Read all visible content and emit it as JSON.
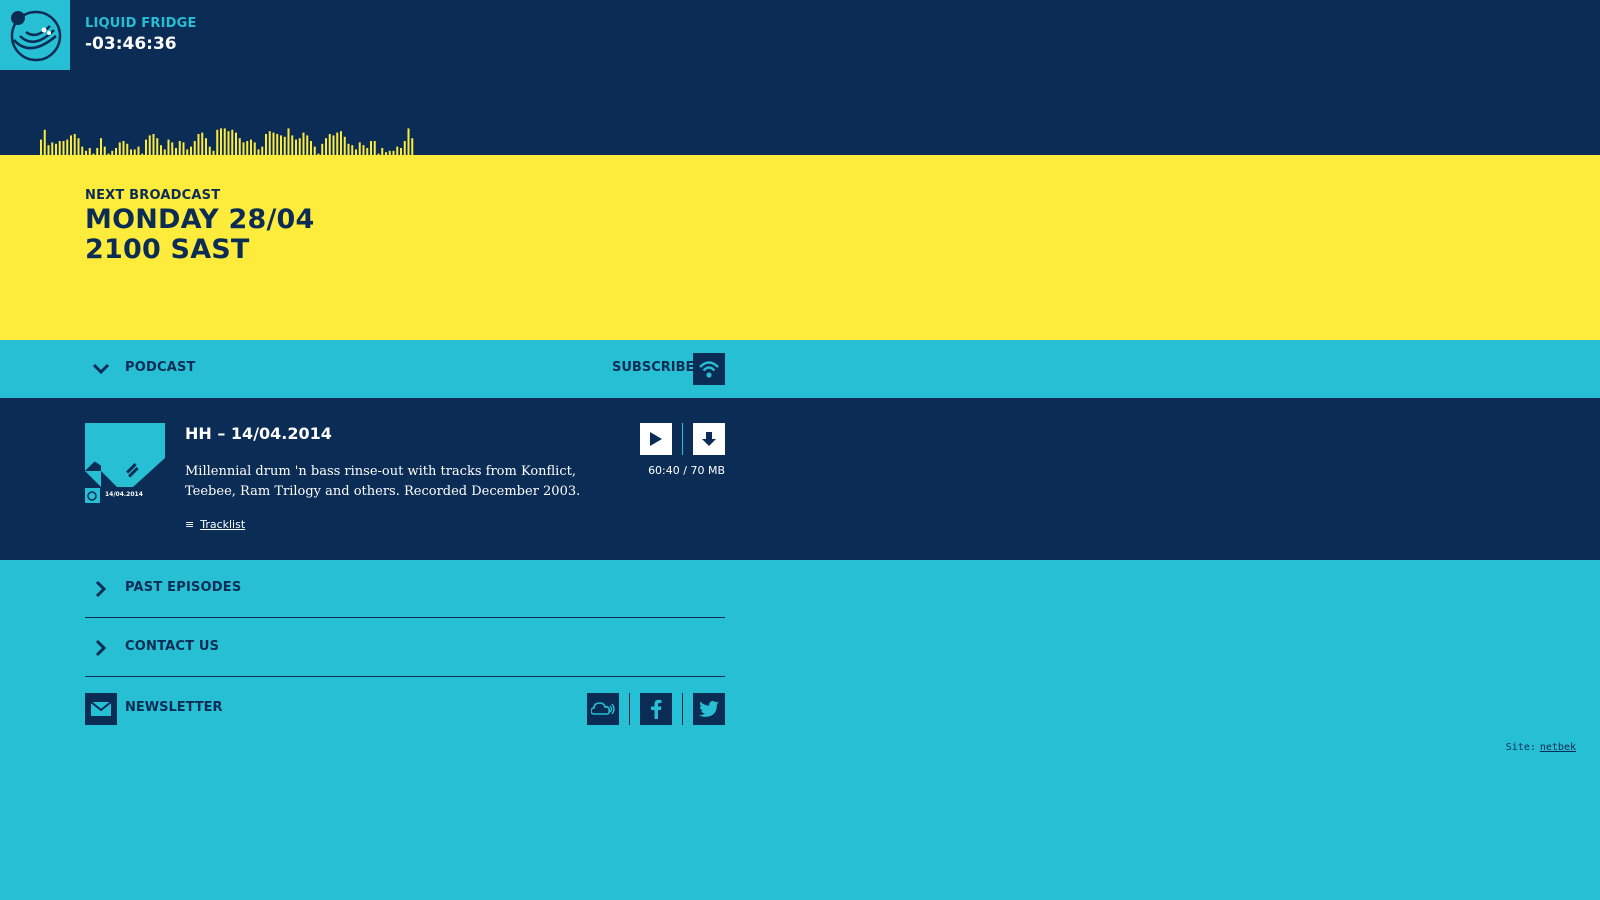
{
  "player": {
    "station_name": "LIQUID FRIDGE",
    "countdown": "-03:46:36",
    "equalizer_levels": [
      0.55,
      0.9,
      0.35,
      0.45,
      0.4,
      0.5,
      0.5,
      0.55,
      0.7,
      0.75,
      0.6,
      0.3,
      0.15,
      0.25,
      0.05,
      0.25,
      0.6,
      0.3,
      0.05,
      0.15,
      0.25,
      0.45,
      0.5,
      0.4,
      0.2,
      0.2,
      0.3,
      0.05,
      0.55,
      0.7,
      0.75,
      0.6,
      0.35,
      0.2,
      0.55,
      0.45,
      0.25,
      0.5,
      0.45,
      0.2,
      0.3,
      0.5,
      0.75,
      0.8,
      0.6,
      0.3,
      0.15,
      0.9,
      0.95,
      0.95,
      0.85,
      0.9,
      0.8,
      0.6,
      0.45,
      0.5,
      0.55,
      0.45,
      0.2,
      0.3,
      0.75,
      0.85,
      0.8,
      0.75,
      0.7,
      0.65,
      0.95,
      0.7,
      0.55,
      0.6,
      0.8,
      0.7,
      0.5,
      0.3,
      0.05,
      0.4,
      0.6,
      0.75,
      0.7,
      0.8,
      0.85,
      0.65,
      0.4,
      0.35,
      0.2,
      0.45,
      0.35,
      0.25,
      0.5,
      0.5,
      0.05,
      0.25,
      0.1,
      0.15,
      0.15,
      0.3,
      0.25,
      0.5,
      0.95,
      0.6
    ]
  },
  "next_broadcast": {
    "label": "NEXT BROADCAST",
    "date": "MONDAY 28/04",
    "time": "2100 SAST"
  },
  "podcast": {
    "label": "PODCAST",
    "subscribe_label": "SUBSCRIBE",
    "episode": {
      "title": "HH – 14/04.2014",
      "description": "Millennial drum 'n bass rinse-out with tracks from Konflict, Teebee, Ram Trilogy and others. Recorded December 2003.",
      "tracklist_label": "Tracklist",
      "duration_size": "60:40 / 70 MB",
      "art_caption": "14/04.2014"
    }
  },
  "menu": {
    "past_episodes": "PAST EPISODES",
    "contact_us": "CONTACT US"
  },
  "footer": {
    "newsletter_label": "NEWSLETTER",
    "social_icons": [
      "soundcloud-icon",
      "facebook-icon",
      "twitter-icon"
    ],
    "credit_prefix": "Site:",
    "credit_link": "netbek"
  },
  "colors": {
    "navy": "#0b2c55",
    "cyan": "#26bfd4",
    "yellow": "#fdec3c",
    "white": "#ffffff"
  }
}
